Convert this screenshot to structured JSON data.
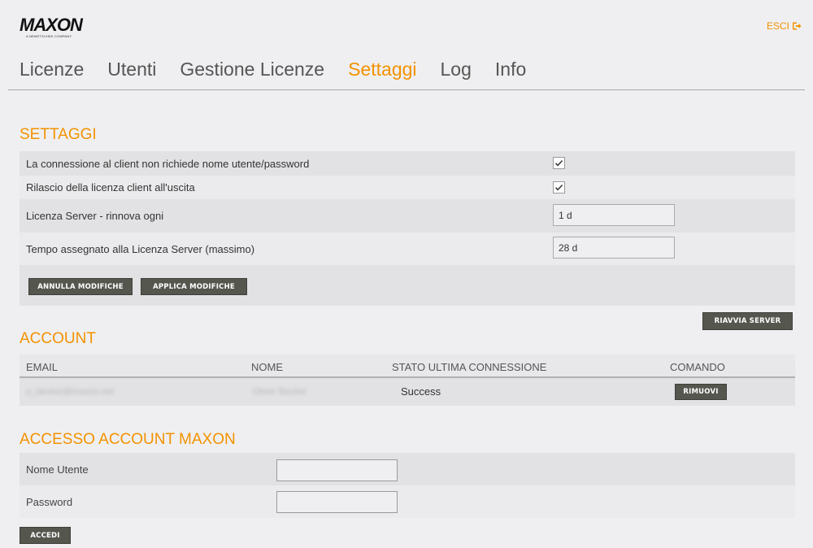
{
  "brand": {
    "logo": "MAXON",
    "tagline": "A NEMETSCHEK COMPANY"
  },
  "header": {
    "logout_label": "ESCI"
  },
  "nav": {
    "tabs": [
      {
        "label": "Licenze"
      },
      {
        "label": "Utenti"
      },
      {
        "label": "Gestione Licenze"
      },
      {
        "label": "Settaggi",
        "active": true
      },
      {
        "label": "Log"
      },
      {
        "label": "Info"
      }
    ]
  },
  "settings": {
    "title": "SETTAGGI",
    "rows": [
      {
        "label": "La connessione al client non richiede nome utente/password",
        "checked": true
      },
      {
        "label": "Rilascio della licenza client all'uscita",
        "checked": true
      },
      {
        "label": "Licenza Server - rinnova ogni",
        "value": "1 d"
      },
      {
        "label": "Tempo assegnato alla Licenza Server (massimo)",
        "value": "28 d"
      }
    ],
    "cancel_label": "ANNULLA MODIFICHE",
    "apply_label": "APPLICA MODIFICHE",
    "restart_label": "RIAVVIA SERVER"
  },
  "account": {
    "title": "ACCOUNT",
    "columns": [
      "EMAIL",
      "NOME",
      "STATO ULTIMA CONNESSIONE",
      "COMANDO"
    ],
    "rows": [
      {
        "email": "o_becker@maxon.net",
        "name": "Oliver Becker",
        "status": "Success",
        "action": "RIMUOVI"
      }
    ]
  },
  "maxon_login": {
    "title": "ACCESSO ACCOUNT MAXON",
    "username_label": "Nome Utente",
    "password_label": "Password",
    "username_value": "",
    "password_value": "",
    "submit_label": "ACCEDI"
  },
  "colors": {
    "accent": "#f39200",
    "button": "#55574f",
    "background": "#efeff1"
  }
}
